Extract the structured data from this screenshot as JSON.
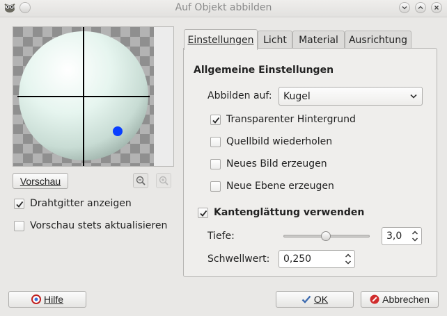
{
  "window": {
    "title": "Auf Objekt abbilden"
  },
  "preview": {
    "button_label": "Vorschau",
    "zoom_in_icon": "zoom-in-icon",
    "zoom_out_icon": "zoom-out-icon"
  },
  "options": {
    "wireframe_label": "Drahtgitter anzeigen",
    "wireframe_checked": true,
    "auto_update_label": "Vorschau stets aktualisieren",
    "auto_update_checked": false
  },
  "tabs": [
    {
      "label": "Einstellungen",
      "active": true
    },
    {
      "label": "Licht",
      "active": false
    },
    {
      "label": "Material",
      "active": false
    },
    {
      "label": "Ausrichtung",
      "active": false
    }
  ],
  "settings": {
    "section_title": "Allgemeine Einstellungen",
    "map_to_label": "Abbilden auf:",
    "map_to_value": "Kugel",
    "checks": [
      {
        "label": "Transparenter Hintergrund",
        "checked": true
      },
      {
        "label": "Quellbild wiederholen",
        "checked": false
      },
      {
        "label": "Neues Bild erzeugen",
        "checked": false
      },
      {
        "label": "Neue Ebene erzeugen",
        "checked": false
      }
    ],
    "antialias_label": "Kantenglättung verwenden",
    "antialias_checked": true,
    "depth_label": "Tiefe:",
    "depth_value": "3,0",
    "threshold_label": "Schwellwert:",
    "threshold_value": "0,250"
  },
  "footer": {
    "help_label": "Hilfe",
    "ok_label": "OK",
    "cancel_label": "Abbrechen"
  },
  "colors": {
    "light_marker": "#0a3fff",
    "sphere_base": "#dff1ea",
    "checker_dark": "#8f8f8f",
    "checker_light": "#b3b3b3"
  }
}
